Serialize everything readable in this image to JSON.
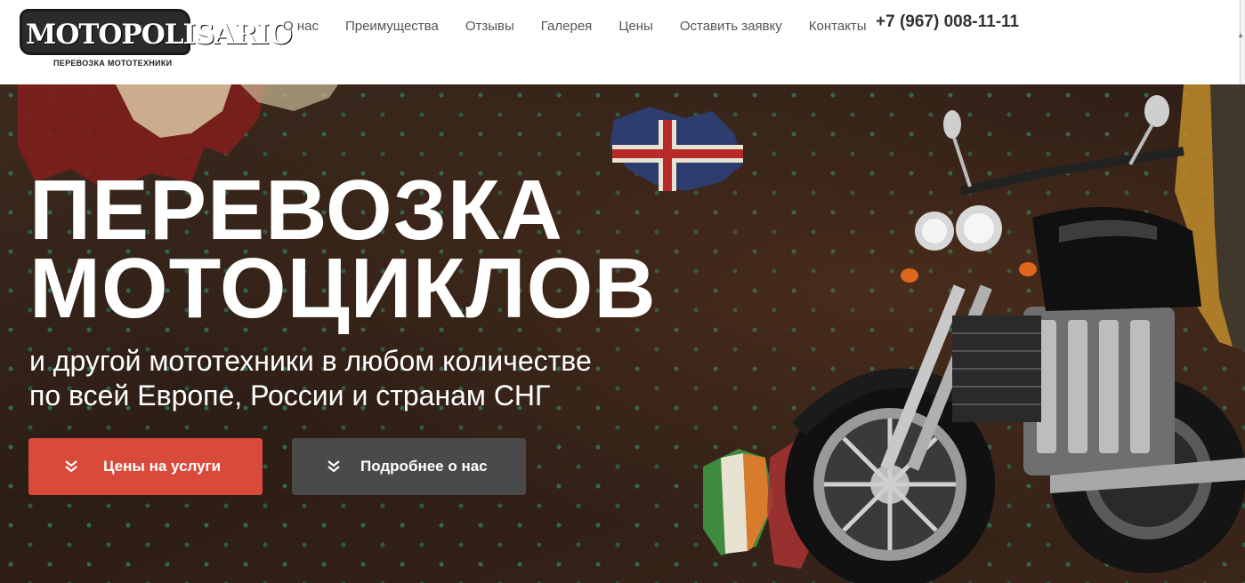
{
  "header": {
    "logo_text": "MOTOPOLISARIO",
    "logo_sub": "ПЕРЕВОЗКА МОТОТЕХНИКИ",
    "nav": [
      {
        "label": "О нас"
      },
      {
        "label": "Преимущества"
      },
      {
        "label": "Отзывы"
      },
      {
        "label": "Галерея"
      },
      {
        "label": "Цены"
      },
      {
        "label": "Оставить заявку"
      },
      {
        "label": "Контакты"
      }
    ],
    "phone": "+7 (967) 008-11-11"
  },
  "hero": {
    "title_line1": "ПЕРЕВОЗКА",
    "title_line2": "МОТОЦИКЛОВ",
    "subtitle_line1": "и другой мототехники в любом количестве",
    "subtitle_line2": "по всей Европе, России и странам СНГ",
    "buttons": {
      "prices_label": "Цены на услуги",
      "about_label": "Подробнее о нас"
    },
    "icons": {
      "button_icon": "double-chevron-down-icon",
      "background": "europe-map-flags",
      "motorcycle": "motorcycle-image"
    },
    "colors": {
      "primary_button": "#d94a3a",
      "secondary_button": "#4a4a4a"
    }
  }
}
